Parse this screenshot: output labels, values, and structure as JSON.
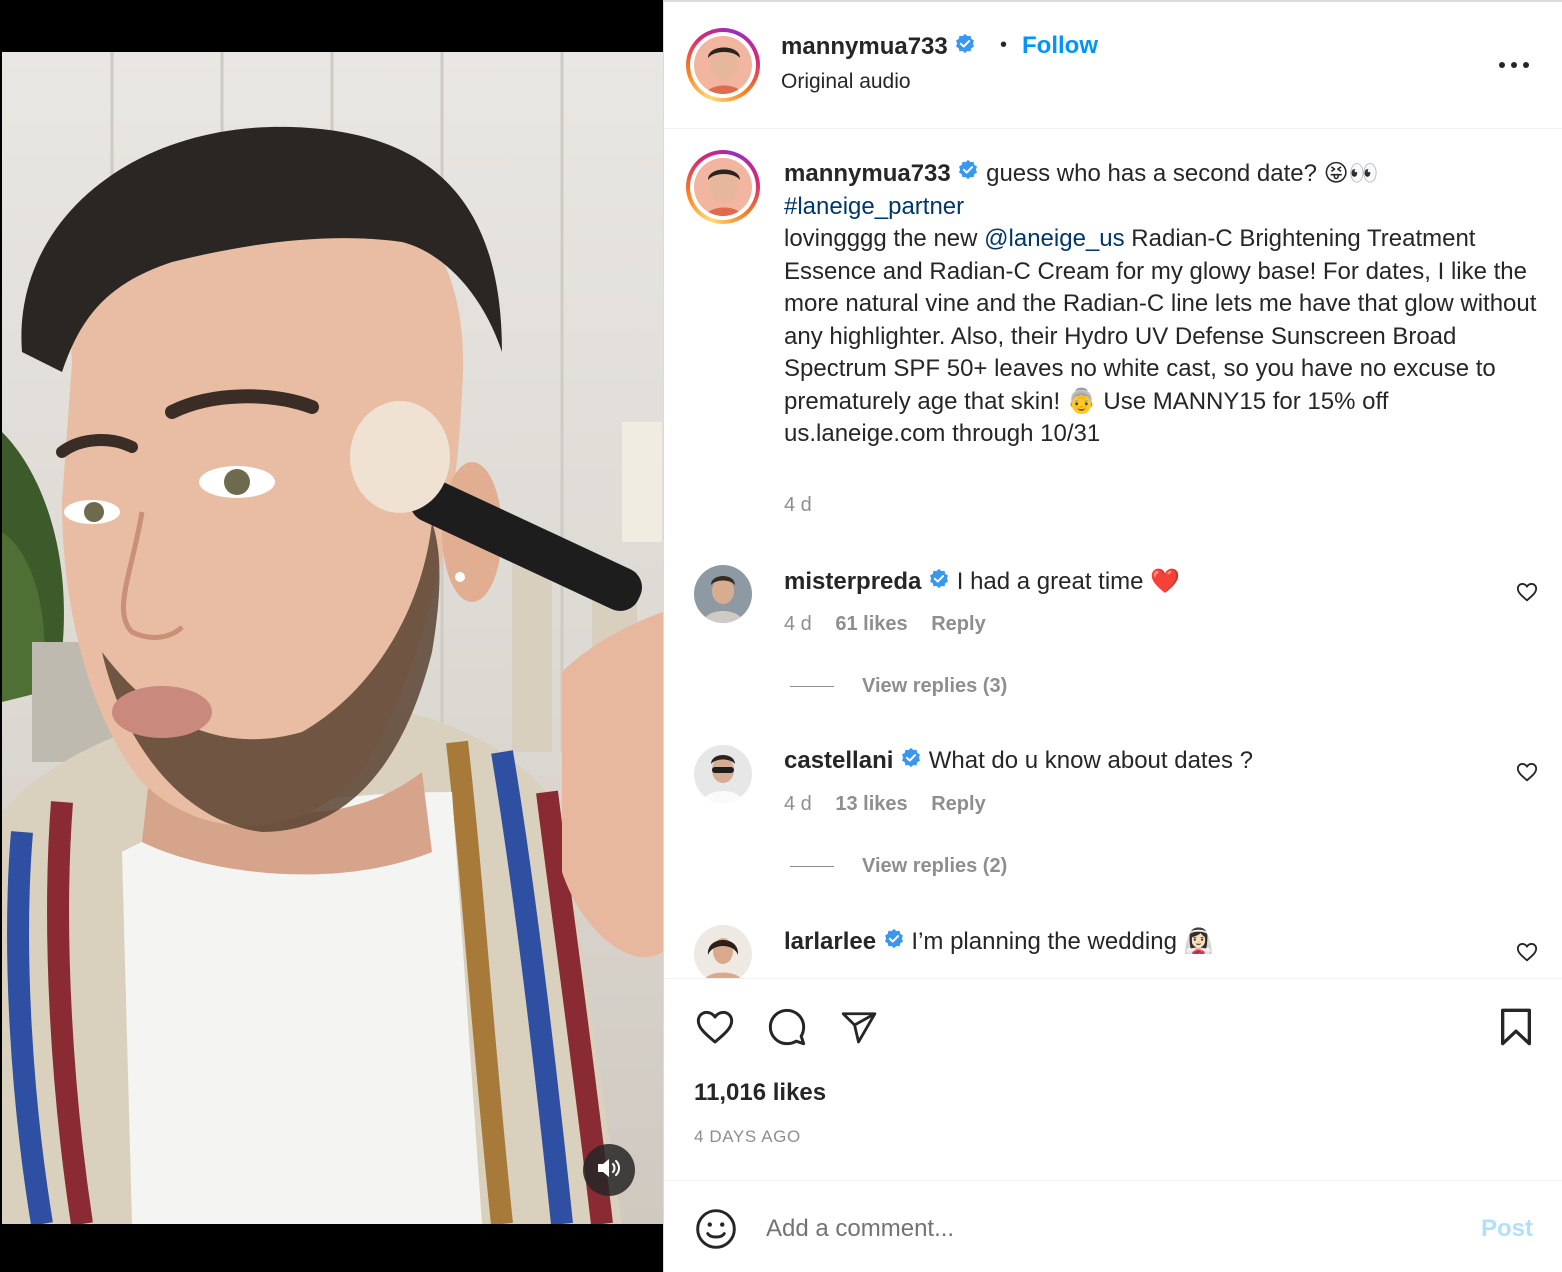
{
  "header": {
    "username": "mannymua733",
    "separator": "•",
    "follow_label": "Follow",
    "audio_label": "Original audio"
  },
  "caption": {
    "username": "mannymua733",
    "line1": " guess who has a second date? 😝👀",
    "hashtag": "#laneige_partner",
    "text_before_mention": "lovingggg the new ",
    "mention": "@laneige_us",
    "text_after_mention": " Radian-C Brightening Treatment Essence and Radian-C Cream for my glowy base! For dates, I like the more natural vine and the Radian-C line lets me have that glow without any highlighter. Also, their Hydro UV Defense Sunscreen Broad Spectrum SPF 50+ leaves no white cast, so you have no excuse to prematurely age that skin! 👵 Use MANNY15 for 15% off us.laneige.com through 10/31",
    "time": "4 d"
  },
  "comments": [
    {
      "username": "misterpreda",
      "text": " I had a great time ❤️",
      "time": "4 d",
      "likes": "61 likes",
      "reply_label": "Reply",
      "view_replies": "View replies (3)"
    },
    {
      "username": "castellani",
      "text": " What do u know about dates ?",
      "time": "4 d",
      "likes": "13 likes",
      "reply_label": "Reply",
      "view_replies": "View replies (2)"
    },
    {
      "username": "larlarlee",
      "text": " I’m planning the wedding 👰🏻‍♀️"
    }
  ],
  "actions": {
    "likes_count": "11,016 likes",
    "post_date": "4 DAYS AGO"
  },
  "comment_box": {
    "placeholder": "Add a comment...",
    "post_label": "Post"
  },
  "icons": {
    "verified": "verified-badge-icon",
    "more": "more-options-icon",
    "like": "heart-icon",
    "comment": "comment-bubble-icon",
    "share": "paper-plane-icon",
    "save": "bookmark-icon",
    "emoji": "emoji-smiley-icon",
    "mute": "speaker-icon"
  },
  "colors": {
    "accent": "#0095f6",
    "link": "#00376b",
    "muted_text": "#8e8e8e",
    "post_disabled": "#b2dffc",
    "verified": "#3897f0"
  }
}
